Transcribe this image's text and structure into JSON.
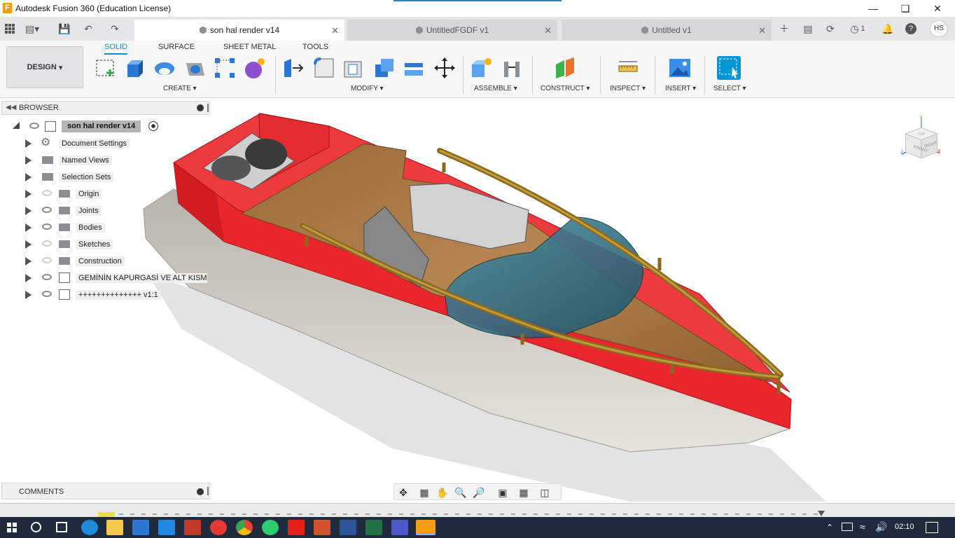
{
  "window": {
    "title": "Autodesk Fusion 360 (Education License)",
    "minimize_icon": "minimize-icon",
    "maximize_icon": "restore-icon",
    "close_icon": "close-icon"
  },
  "tabs": [
    {
      "label": "son hal render v14",
      "active": true
    },
    {
      "label": "UntitledFGDF v1",
      "active": false
    },
    {
      "label": "Untitled v1",
      "active": false
    }
  ],
  "account": {
    "job_count": "1",
    "initials": "HS"
  },
  "ribbon": {
    "workspace": "DESIGN",
    "workspace_tabs": [
      "SOLID",
      "SURFACE",
      "SHEET METAL",
      "TOOLS"
    ],
    "groups": [
      "CREATE",
      "MODIFY",
      "ASSEMBLE",
      "CONSTRUCT",
      "INSPECT",
      "INSERT",
      "SELECT"
    ]
  },
  "browser": {
    "title": "BROWSER",
    "root": "son hal render v14",
    "items": [
      {
        "label": "Document Settings",
        "icon": "gear-icon"
      },
      {
        "label": "Named Views",
        "icon": "folder-icon"
      },
      {
        "label": "Selection Sets",
        "icon": "folder-icon"
      },
      {
        "label": "Origin",
        "icon": "folder-icon",
        "visible": false
      },
      {
        "label": "Joints",
        "icon": "folder-icon",
        "visible": true
      },
      {
        "label": "Bodies",
        "icon": "folder-icon",
        "visible": true
      },
      {
        "label": "Sketches",
        "icon": "folder-icon",
        "visible": false
      },
      {
        "label": "Construction",
        "icon": "folder-icon",
        "visible": false
      },
      {
        "label": "GEMİNİN KAPURGASİ VE ALT KISM...",
        "icon": "component-icon",
        "visible": true
      },
      {
        "label": "++++++++++++++ v1:1",
        "icon": "component-icon",
        "visible": true
      }
    ]
  },
  "comments": {
    "title": "COMMENTS"
  },
  "viewcube": {
    "front": "FRONT",
    "right": "RIGHT",
    "top": "TOP",
    "x": "X",
    "y": "Y",
    "z": "Z"
  },
  "clock": "02:10",
  "colors": {
    "accent": "#0696d7",
    "hull_red": "#e8262b",
    "deck_wood": "#a0703a"
  }
}
